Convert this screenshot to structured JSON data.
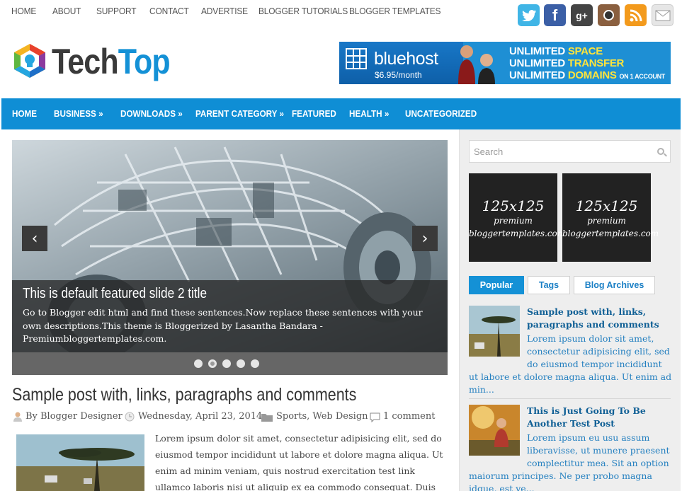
{
  "top_nav": [
    "HOME",
    "ABOUT",
    "SUPPORT",
    "CONTACT",
    "ADVERTISE",
    "BLOGGER TUTORIALS",
    "BLOGGER TEMPLATES"
  ],
  "social": [
    {
      "name": "twitter-icon",
      "color": "#40b5e6"
    },
    {
      "name": "facebook-icon",
      "color": "#3b5fa6"
    },
    {
      "name": "google-plus-icon",
      "color": "#444444"
    },
    {
      "name": "instagram-icon",
      "color": "#8a5f3f"
    },
    {
      "name": "rss-icon",
      "color": "#f39a1c"
    },
    {
      "name": "email-icon",
      "color": "#dddddd"
    }
  ],
  "logo": {
    "part1": "Tech",
    "part2": "Top"
  },
  "ad_banner": {
    "brand": "bluehost",
    "price": "$6.95/month",
    "line1_a": "UNLIMITED ",
    "line1_b": "SPACE",
    "line2_a": "UNLIMITED ",
    "line2_b": "TRANSFER",
    "line3_a": "UNLIMITED ",
    "line3_b": "DOMAINS",
    "line3_c": "ON 1 ACCOUNT"
  },
  "main_nav": [
    "HOME",
    "BUSINESS »",
    "DOWNLOADS »",
    "PARENT CATEGORY »",
    "FEATURED",
    "HEALTH »",
    "UNCATEGORIZED"
  ],
  "slider": {
    "title": "This is default featured slide 2 title",
    "description": "Go to Blogger edit html and find these sentences.Now replace these sentences with your own descriptions.This theme is Bloggerized by Lasantha Bandara - Premiumbloggertemplates.com.",
    "prev": "‹",
    "next": "›",
    "active_dot": 2
  },
  "post": {
    "title": "Sample post with, links, paragraphs and comments",
    "by": "By",
    "author": "Blogger Designer",
    "date": "Wednesday, April 23, 2014",
    "categories": "Sports, Web Design",
    "comments": "1 comment",
    "excerpt": "Lorem ipsum dolor sit amet, consectetur adipisicing elit, sed do eiusmod tempor incididunt ut labore et dolore magna aliqua. Ut enim ad minim veniam, quis nostrud exercitation test link ullamco laboris nisi ut aliquip ex ea commodo consequat. Duis"
  },
  "sidebar": {
    "search_placeholder": "Search",
    "ads": [
      {
        "size": "125x125",
        "label": "premium",
        "site": "bloggertemplates.com"
      },
      {
        "size": "125x125",
        "label": "premium",
        "site": "bloggertemplates.com"
      }
    ],
    "tabs": [
      "Popular",
      "Tags",
      "Blog Archives"
    ],
    "popular": [
      {
        "title": "Sample post with, links, paragraphs and comments",
        "text_a": "Lorem ipsum dolor sit amet,",
        "text_b": "consectetur adipisicing elit, sed",
        "text_c": "do eiusmod tempor incididunt",
        "text_d": "ut labore et dolore magna aliqua. Ut enim ad",
        "text_e": "min..."
      },
      {
        "title": "This is Just Going To Be Another Test Post",
        "text_a": "Lorem ipsum eu usu assum",
        "text_b": "liberavisse, ut munere praesent",
        "text_c": "complectitur mea. Sit an option",
        "text_d": "maiorum principes. Ne per probo magna",
        "text_e": "idque, est ve..."
      }
    ]
  },
  "colors": {
    "accent": "#1491d6",
    "nav": "#0f8ed5",
    "link": "#1a7fc5"
  }
}
